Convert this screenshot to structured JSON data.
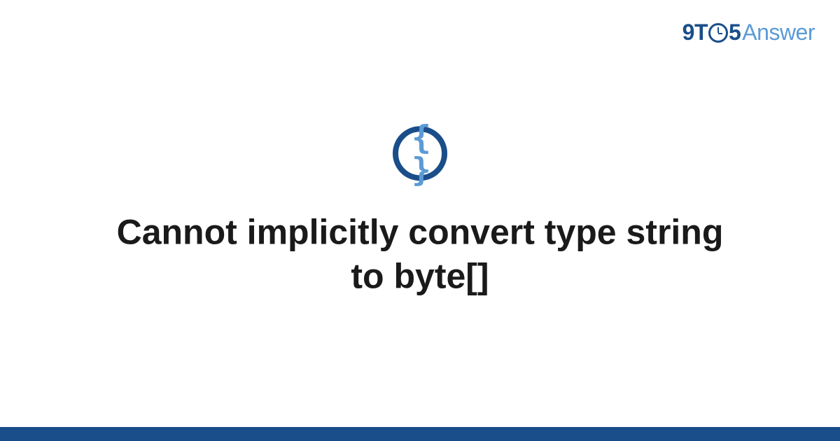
{
  "logo": {
    "part1": "9",
    "part2": "T",
    "part3": "5",
    "part4": "Answer"
  },
  "icon": {
    "name": "code-braces-icon",
    "glyph": "{ }"
  },
  "title": "Cannot implicitly convert type string to byte[]",
  "colors": {
    "brand_dark": "#1a4e8a",
    "brand_light": "#5b9bd5",
    "text": "#1a1a1a",
    "bg": "#ffffff"
  }
}
